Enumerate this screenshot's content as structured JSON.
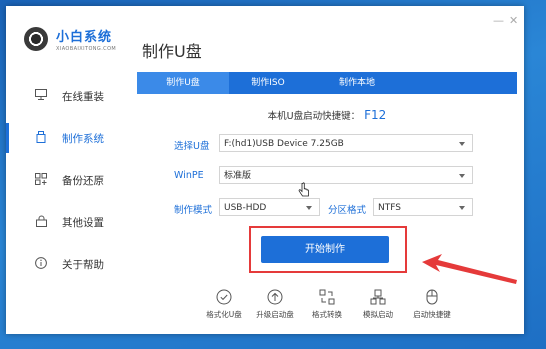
{
  "app": {
    "name": "小白系统",
    "sub": "XIAOBAIXITONG.COM",
    "page_title": "制作U盘"
  },
  "sidebar": {
    "items": [
      {
        "label": "在线重装",
        "icon": "monitor-icon"
      },
      {
        "label": "制作系统",
        "icon": "usb-icon",
        "active": true
      },
      {
        "label": "备份还原",
        "icon": "backup-icon"
      },
      {
        "label": "其他设置",
        "icon": "lock-icon"
      },
      {
        "label": "关于帮助",
        "icon": "info-icon"
      }
    ]
  },
  "tabs": [
    {
      "label": "制作U盘",
      "active": true
    },
    {
      "label": "制作ISO"
    },
    {
      "label": "制作本地"
    }
  ],
  "shortcut": {
    "label": "本机U盘启动快捷键：",
    "key": "F12"
  },
  "form": {
    "usb": {
      "label": "选择U盘",
      "value": "F:(hd1)USB Device 7.25GB"
    },
    "winpe": {
      "label": "WinPE",
      "value": "标准版"
    },
    "mode": {
      "label": "制作模式",
      "value": "USB-HDD"
    },
    "partition": {
      "label": "分区格式",
      "value": "NTFS"
    }
  },
  "start_button": "开始制作",
  "tools": [
    {
      "label": "格式化U盘",
      "icon": "check-circle-icon"
    },
    {
      "label": "升级启动盘",
      "icon": "upload-circle-icon"
    },
    {
      "label": "格式转换",
      "icon": "convert-icon"
    },
    {
      "label": "模拟启动",
      "icon": "simulate-icon"
    },
    {
      "label": "启动快捷键",
      "icon": "mouse-icon"
    }
  ],
  "colors": {
    "accent": "#1d6fd8",
    "highlight": "#e53a3a"
  }
}
